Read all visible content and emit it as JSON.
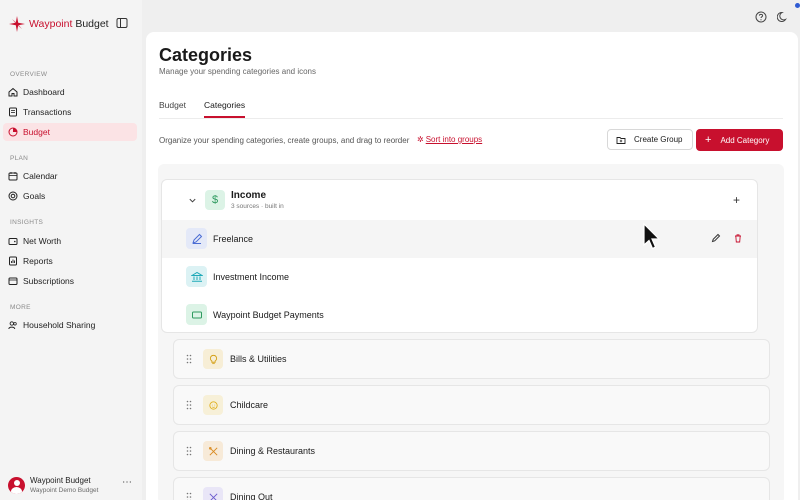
{
  "app": {
    "brand_prefix": "Waypoint",
    "brand_suffix": "Budget",
    "accent": "#c8102e"
  },
  "sidebar": {
    "sections": {
      "overview": "OVERVIEW",
      "plan": "PLAN",
      "insights": "INSIGHTS",
      "more": "MORE"
    },
    "items": [
      {
        "label": "Dashboard",
        "icon": "home-icon"
      },
      {
        "label": "Transactions",
        "icon": "receipt-icon"
      },
      {
        "label": "Budget",
        "icon": "budget-icon",
        "active": true
      },
      {
        "label": "Calendar",
        "icon": "calendar-icon"
      },
      {
        "label": "Goals",
        "icon": "target-icon"
      },
      {
        "label": "Net Worth",
        "icon": "wallet-icon"
      },
      {
        "label": "Reports",
        "icon": "report-icon"
      },
      {
        "label": "Subscriptions",
        "icon": "subscription-icon"
      },
      {
        "label": "Household Sharing",
        "icon": "users-icon"
      }
    ],
    "user": {
      "name": "Waypoint Budget",
      "subtitle": "Waypoint Demo Budget"
    }
  },
  "main": {
    "title": "Categories",
    "subtitle": "Manage your spending categories and icons",
    "tabs": [
      {
        "label": "Budget",
        "active": false
      },
      {
        "label": "Categories",
        "active": true
      }
    ],
    "instructions": "Organize your spending categories, create groups, and drag to reorder",
    "sort_link": "Sort into groups",
    "create_group_label": "Create Group",
    "add_category_label": "Add Category",
    "group": {
      "name": "Income",
      "meta": "3 sources · built in",
      "icon": "dollar-icon",
      "items": [
        {
          "name": "Freelance",
          "icon": "pen-icon",
          "color": "#4a6cd4",
          "bg": "#e4e9f8"
        },
        {
          "name": "Investment Income",
          "icon": "bank-icon",
          "color": "#1fa9b8",
          "bg": "#dcf2f4"
        },
        {
          "name": "Waypoint Budget Payments",
          "icon": "card-icon",
          "color": "#2e9a5f",
          "bg": "#dcf3e6"
        }
      ]
    },
    "categories": [
      {
        "name": "Bills & Utilities",
        "icon": "lightbulb-icon",
        "color": "#d4a017",
        "bg": "#f7eed6"
      },
      {
        "name": "Childcare",
        "icon": "baby-icon",
        "color": "#e0b020",
        "bg": "#f7f0d8"
      },
      {
        "name": "Dining & Restaurants",
        "icon": "utensils-icon",
        "color": "#d98a1f",
        "bg": "#f7ead8"
      },
      {
        "name": "Dining Out",
        "icon": "fork-icon",
        "color": "#6a5acd",
        "bg": "#e9e6f7"
      }
    ]
  }
}
